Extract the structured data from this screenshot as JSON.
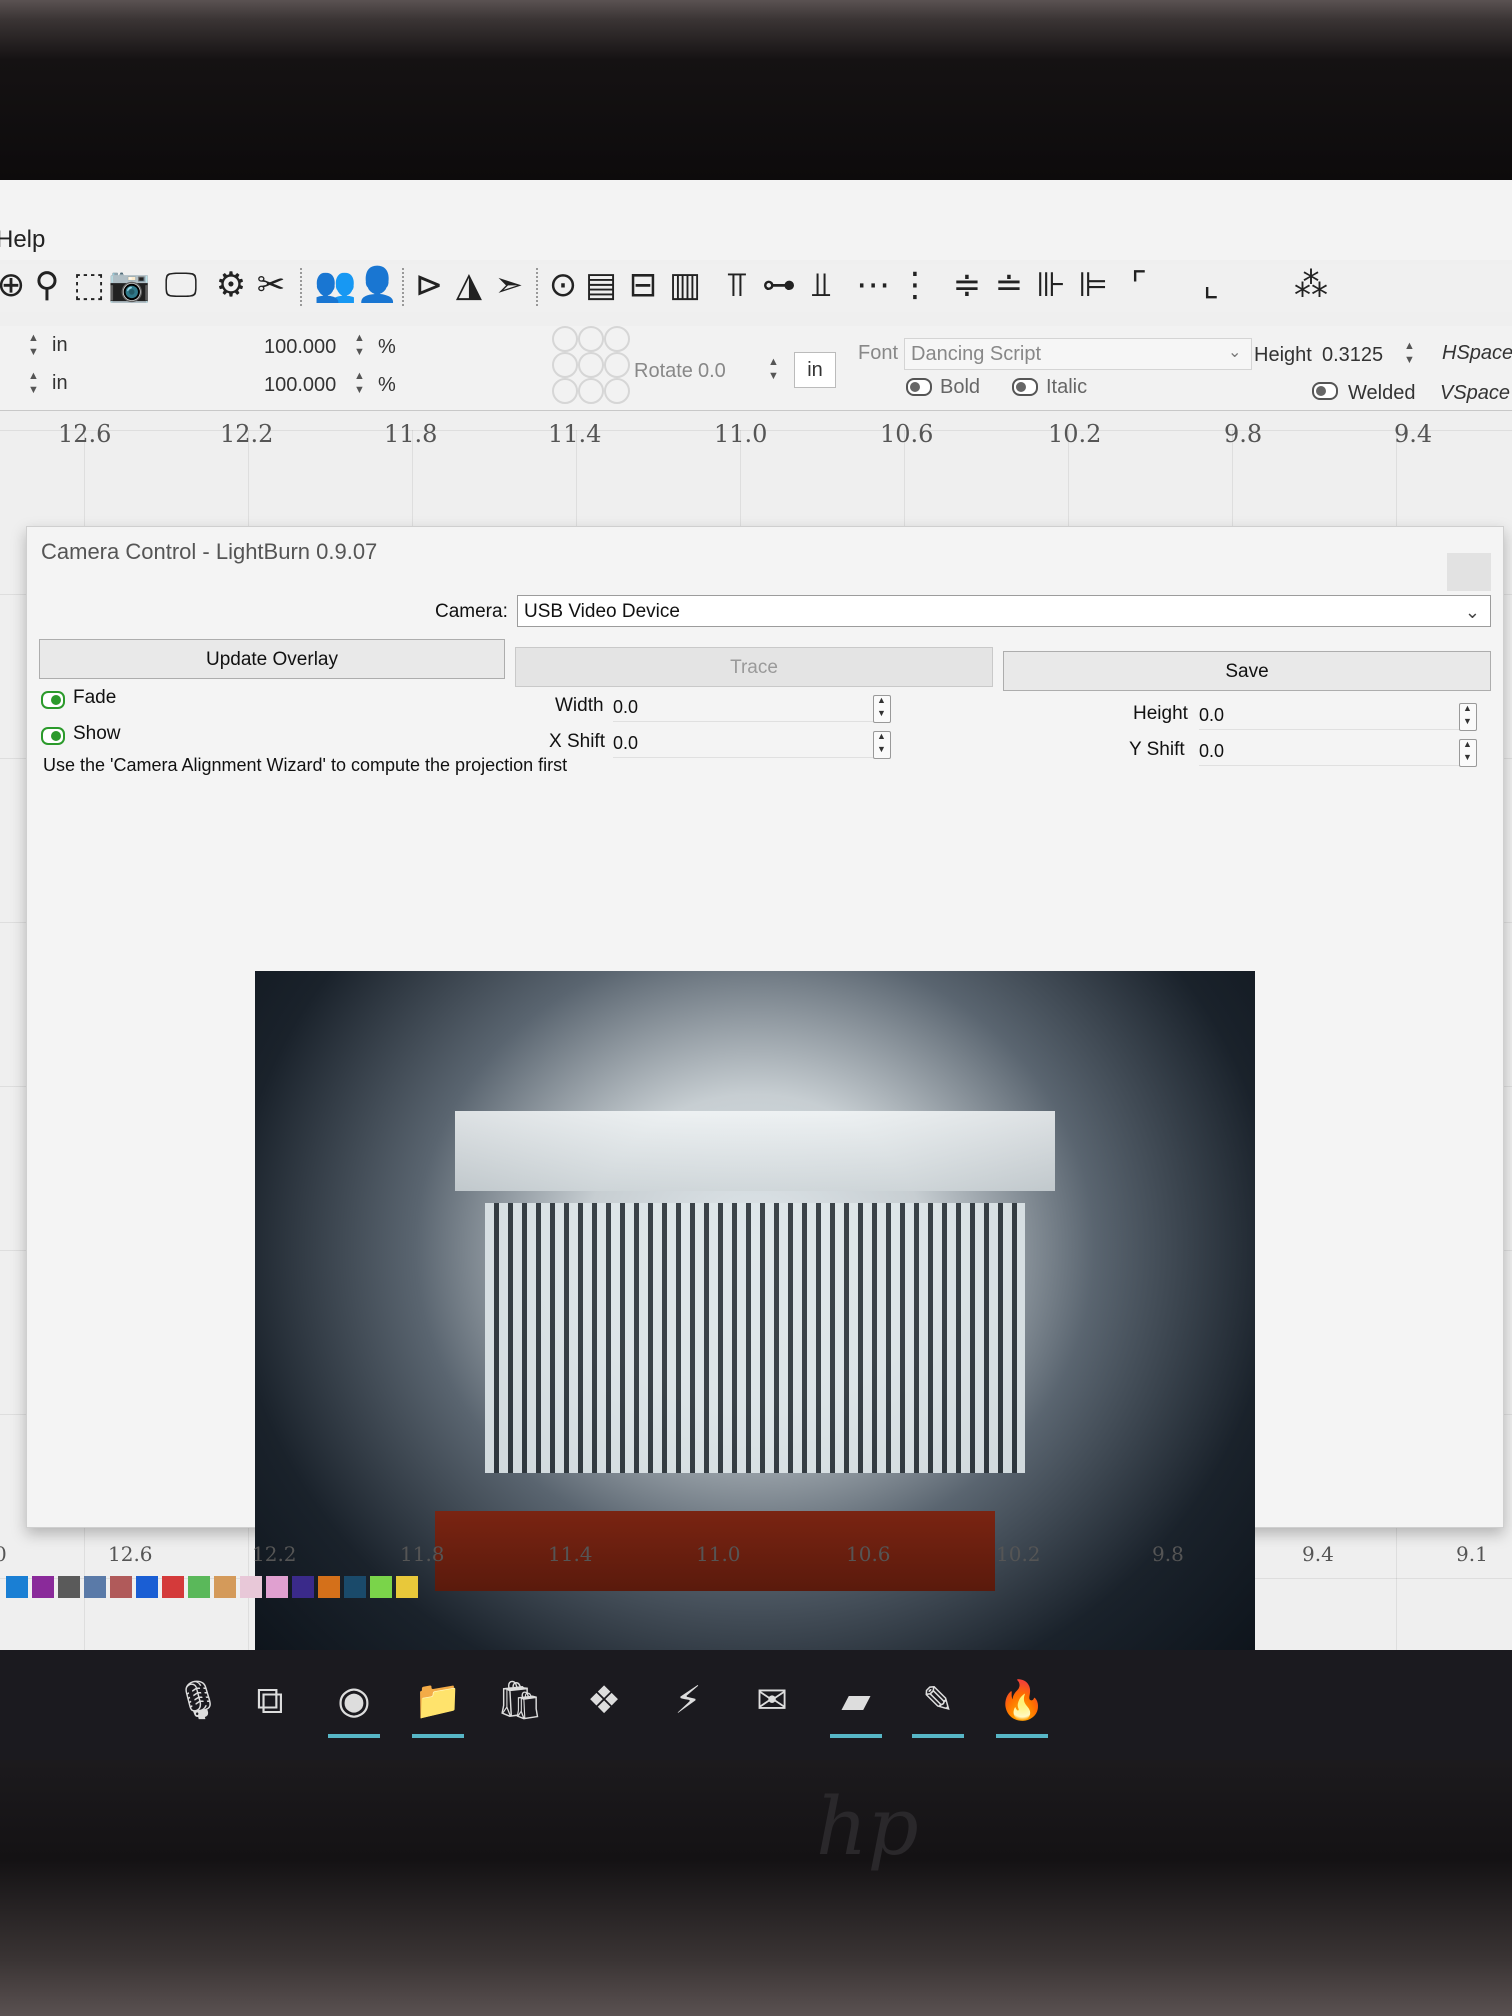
{
  "menu": {
    "help": "Help"
  },
  "toolbar": {
    "icons": [
      "zoom-in-icon",
      "zoom-out-icon",
      "select-frame-icon",
      "camera-icon",
      "monitor-icon",
      "gear-icon",
      "tools-icon",
      "group-icon",
      "user-icon",
      "text-tool-icon",
      "mirror-icon",
      "arrow-icon",
      "target-icon",
      "align-left-icon",
      "align-center-icon",
      "align-right-icon",
      "align-top-icon",
      "align-middle-icon",
      "align-bottom-icon",
      "distribute-h-icon",
      "distribute-v-icon",
      "dock-h-icon",
      "dock-v-icon",
      "dock-center-icon",
      "dock-right-icon",
      "corner-icon",
      "step-icon",
      "grid-step-icon"
    ]
  },
  "props": {
    "unit1": "in",
    "unit2": "in",
    "scale1": "100.000",
    "scale2": "100.000",
    "pct1": "%",
    "pct2": "%",
    "rotate_label": "Rotate",
    "rotate_value": "0.0",
    "rotate_unit": "in",
    "font_label": "Font",
    "font_value": "Dancing Script",
    "height_label": "Height",
    "height_value": "0.3125",
    "hspace_label": "HSpace",
    "vspace_label": "VSpace",
    "bold": "Bold",
    "italic": "Italic",
    "welded": "Welded"
  },
  "ruler_top": [
    "12.6",
    "12.2",
    "11.8",
    "11.4",
    "11.0",
    "10.6",
    "10.2",
    "9.8",
    "9.4"
  ],
  "ruler_bottom": [
    "0",
    "12.6",
    "12.2",
    "11.8",
    "11.4",
    "11.0",
    "10.6",
    "10.2",
    "9.8",
    "9.4",
    "9.1"
  ],
  "dialog": {
    "title": "Camera Control - LightBurn 0.9.07",
    "camera_label": "Camera:",
    "camera_value": "USB Video Device",
    "update_overlay": "Update Overlay",
    "trace": "Trace",
    "save": "Save",
    "fade": "Fade",
    "show": "Show",
    "width_label": "Width",
    "width_value": "0.0",
    "xshift_label": "X Shift",
    "xshift_value": "0.0",
    "height_label": "Height",
    "height_value": "0.0",
    "yshift_label": "Y Shift",
    "yshift_value": "0.0",
    "hint": "Use the 'Camera Alignment Wizard' to compute the projection first"
  },
  "palette": [
    "#1a7fd4",
    "#8a2a9a",
    "#5a5a5a",
    "#5a7aa8",
    "#b05a5a",
    "#1a5ed4",
    "#d43a3a",
    "#5ab85a",
    "#d49a5a",
    "#e8c8d8",
    "#e0a0d0",
    "#3a2a8a",
    "#d4701a",
    "#1a4a6a",
    "#7ad44a",
    "#e8c83a"
  ],
  "taskbar": {
    "items": [
      "microphone-icon",
      "task-view-icon",
      "chrome-icon",
      "file-explorer-icon",
      "store-icon",
      "dropbox-icon",
      "vscode-icon",
      "mail-icon",
      "sticky-notes-icon",
      "inkscape-icon",
      "lightburn-icon"
    ]
  }
}
